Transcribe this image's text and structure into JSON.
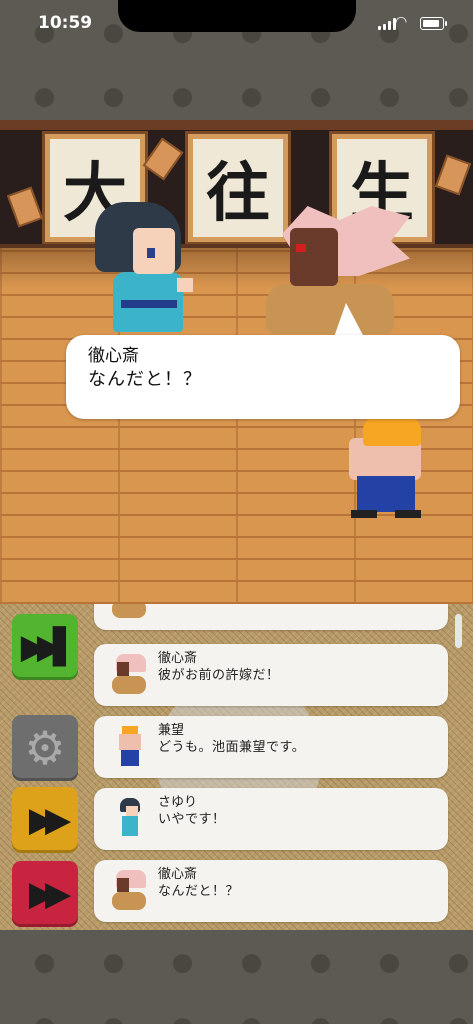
{
  "status_bar": {
    "time": "10:59"
  },
  "scene": {
    "scroll_chars": [
      "大",
      "往",
      "生"
    ]
  },
  "dialogue": {
    "speaker": "徹心斎",
    "line": "なんだと！？"
  },
  "controls": {
    "skip_icon": "skip-forward-icon",
    "settings_icon": "gear-icon",
    "fast_forward_icon": "fast-forward-icon",
    "auto_icon": "auto-play-icon"
  },
  "log": [
    {
      "name": "",
      "text": "",
      "avatar": "tesshin"
    },
    {
      "name": "徹心斎",
      "text": "彼がお前の許嫁だ！",
      "avatar": "tesshin"
    },
    {
      "name": "兼望",
      "text": "どうも。池面兼望です。",
      "avatar": "kenbo"
    },
    {
      "name": "さゆり",
      "text": "いやです！",
      "avatar": "sayuri"
    },
    {
      "name": "徹心斎",
      "text": "なんだと！？",
      "avatar": "tesshin"
    }
  ]
}
